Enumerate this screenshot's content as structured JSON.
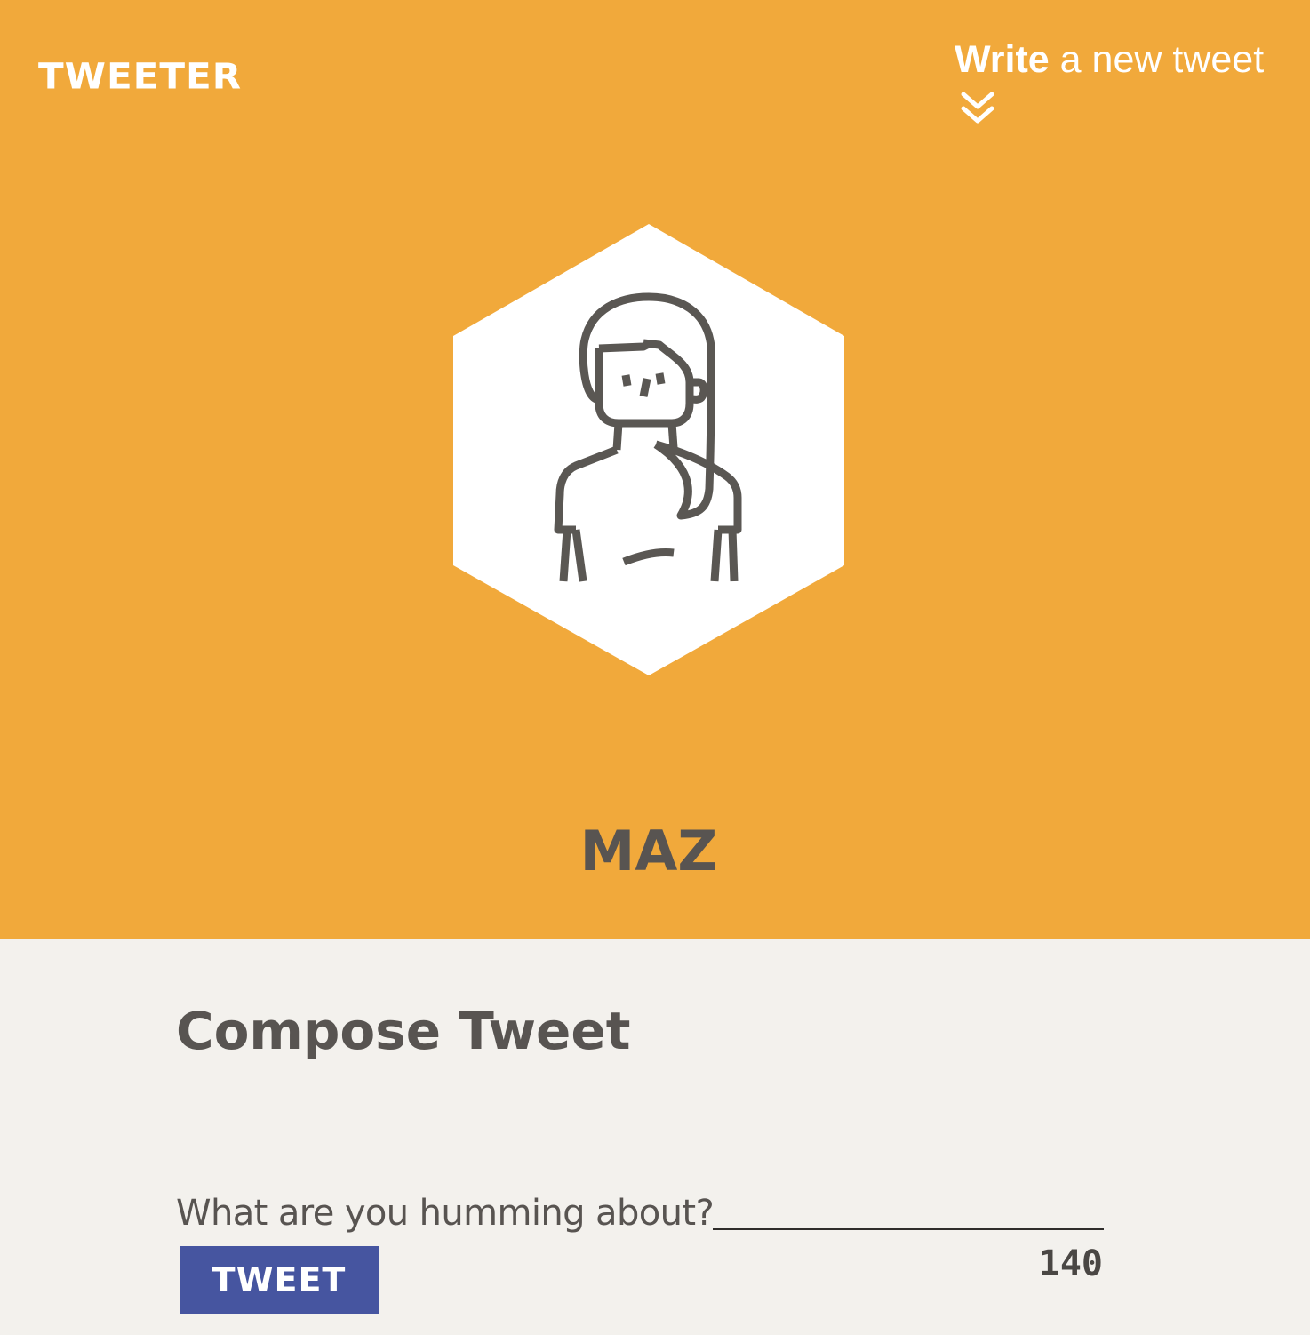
{
  "header": {
    "brand": "TWEETER",
    "write_link": {
      "strong": "Write",
      "rest": " a new tweet",
      "icon": "double-chevron-down-icon"
    },
    "background_color": "#f1a93b"
  },
  "profile": {
    "name": "MAZ",
    "avatar_icon": "woman-avatar-icon"
  },
  "compose": {
    "title": "Compose Tweet",
    "label": "What are you humming about?",
    "input_value": "",
    "button_label": "TWEET",
    "button_color": "#4655a0",
    "char_count": "140"
  }
}
